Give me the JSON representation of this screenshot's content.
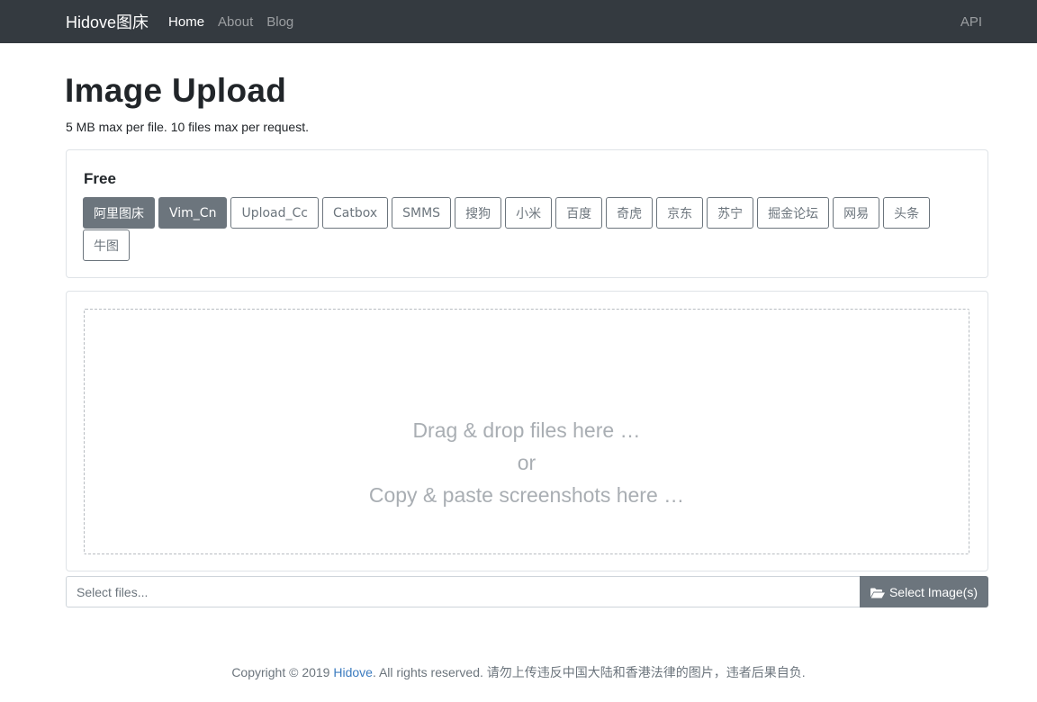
{
  "navbar": {
    "brand": "Hidove图床",
    "links": [
      "Home",
      "About",
      "Blog"
    ],
    "api": "API"
  },
  "page": {
    "title": "Image Upload",
    "subtitle": "5 MB max per file. 10 files max per request."
  },
  "free_card": {
    "title": "Free",
    "hosts": [
      {
        "label": "阿里图床",
        "selected": true
      },
      {
        "label": "Vim_Cn",
        "selected": true
      },
      {
        "label": "Upload_Cc",
        "selected": false
      },
      {
        "label": "Catbox",
        "selected": false
      },
      {
        "label": "SMMS",
        "selected": false
      },
      {
        "label": "搜狗",
        "selected": false
      },
      {
        "label": "小米",
        "selected": false
      },
      {
        "label": "百度",
        "selected": false
      },
      {
        "label": "奇虎",
        "selected": false
      },
      {
        "label": "京东",
        "selected": false
      },
      {
        "label": "苏宁",
        "selected": false
      },
      {
        "label": "掘金论坛",
        "selected": false
      },
      {
        "label": "网易",
        "selected": false
      },
      {
        "label": "头条",
        "selected": false
      },
      {
        "label": "牛图",
        "selected": false
      }
    ]
  },
  "dropzone": {
    "line1": "Drag & drop files here …",
    "line2": "or",
    "line3": "Copy & paste screenshots here …"
  },
  "file_bar": {
    "placeholder": "Select files...",
    "button_label": "Select Image(s)",
    "button_icon": "folder-open-icon"
  },
  "footer": {
    "prefix": "Copyright © 2019 ",
    "link": "Hidove",
    "suffix": ". All rights reserved. 请勿上传违反中国大陆和香港法律的图片，违者后果自负."
  },
  "colors": {
    "navbar_bg": "#343a40",
    "secondary": "#6c757d",
    "link": "#3b7bbf"
  }
}
